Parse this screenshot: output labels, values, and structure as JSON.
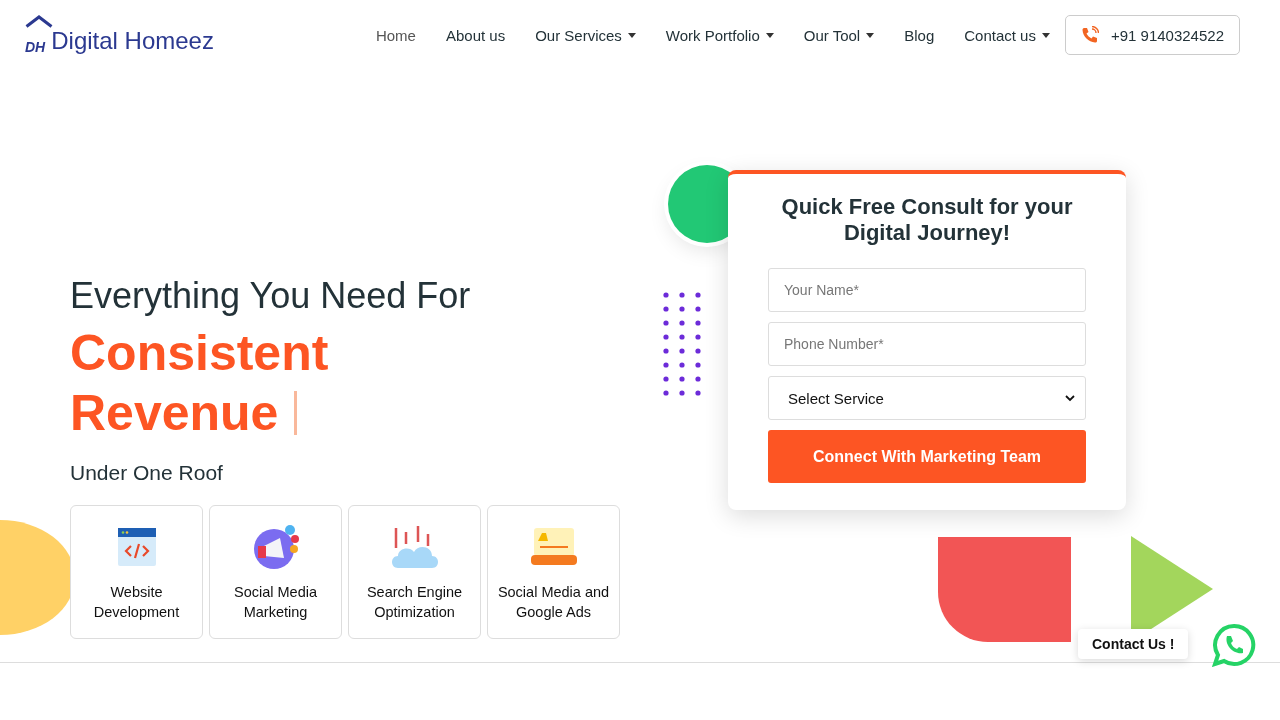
{
  "header": {
    "logo_mark": "DH",
    "logo_text": "Digital Homeez",
    "nav": [
      {
        "label": "Home",
        "selected": true,
        "dropdown": false
      },
      {
        "label": "About us",
        "selected": false,
        "dropdown": false
      },
      {
        "label": "Our Services",
        "selected": false,
        "dropdown": true
      },
      {
        "label": "Work Portfolio",
        "selected": false,
        "dropdown": true
      },
      {
        "label": "Our Tool",
        "selected": false,
        "dropdown": true
      },
      {
        "label": "Blog",
        "selected": false,
        "dropdown": false
      },
      {
        "label": "Contact us",
        "selected": false,
        "dropdown": true
      }
    ],
    "phone": "+91 9140324522"
  },
  "hero": {
    "intro": "Everything You Need For",
    "highlight": [
      "Consistent",
      "Revenue"
    ],
    "subtitle": "Under One Roof",
    "services": [
      {
        "kind": "code",
        "label": "Website Development"
      },
      {
        "kind": "megaphone",
        "label": "Social Media Marketing"
      },
      {
        "kind": "seo",
        "label": "Search Engine Optimization"
      },
      {
        "kind": "ads",
        "label": "Social Media and Google Ads"
      }
    ]
  },
  "form": {
    "title": "Quick Free Consult for your Digital Journey!",
    "name_placeholder": "Your Name*",
    "phone_placeholder": "Phone Number*",
    "service_select": "Select Service",
    "submit": "Connect With Marketing Team"
  },
  "contact_chip": "Contact Us !"
}
